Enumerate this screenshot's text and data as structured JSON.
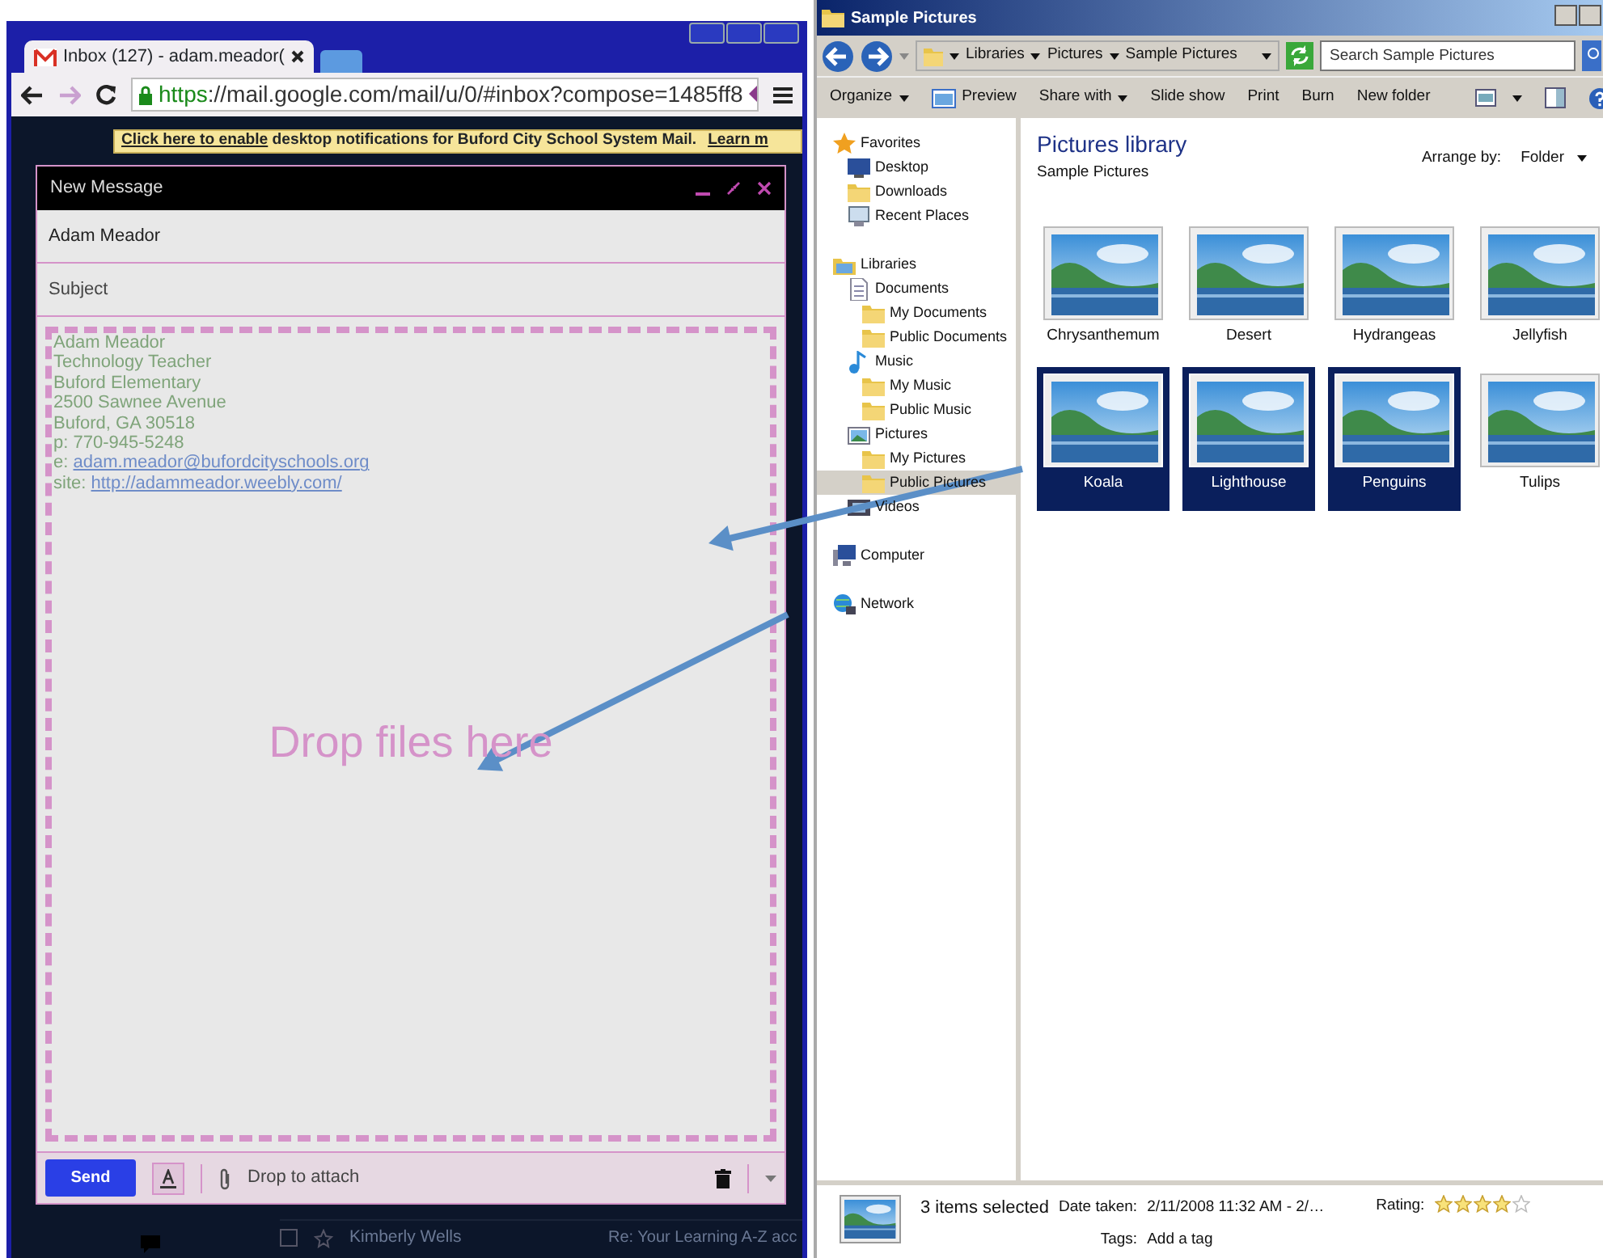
{
  "browser": {
    "tab_title": "Inbox (127) - adam.meador(",
    "url": "https://mail.google.com/mail/u/0/#inbox?compose=1485ff8",
    "notification": {
      "link": "Click here to enable",
      "text": " desktop notifications for Buford City School System Mail.",
      "learn_more": "Learn m"
    },
    "inbox_rows": [
      {
        "sender": "Kimberly Wells",
        "subject": "Re: Your Learning A-Z acc",
        "checked": false
      }
    ]
  },
  "compose": {
    "title": "New Message",
    "to": "Adam Meador",
    "subject_placeholder": "Subject",
    "signature": [
      {
        "text": "Adam Meador"
      },
      {
        "text": "Technology Teacher"
      },
      {
        "text": "Buford Elementary"
      },
      {
        "text": "2500 Sawnee Avenue"
      },
      {
        "text": "Buford, GA 30518"
      },
      {
        "text": "p: 770-945-5248"
      },
      {
        "text": "e:",
        "link": "adam.meador@bufordcityschools.org"
      },
      {
        "text": "site:",
        "link": "http://adammeador.weebly.com/"
      }
    ],
    "drop_text": "Drop files here",
    "send": "Send",
    "attach_text": "Drop to attach"
  },
  "explorer": {
    "title": "Sample Pictures",
    "breadcrumb": [
      "Libraries",
      "Pictures",
      "Sample Pictures"
    ],
    "search_placeholder": "Search Sample Pictures",
    "toolbar": [
      {
        "label": "Organize",
        "dropdown": true,
        "kind": "text"
      },
      {
        "label": "Preview",
        "dropdown": false,
        "kind": "preview"
      },
      {
        "label": "Share with",
        "dropdown": true,
        "kind": "text"
      },
      {
        "label": "Slide show",
        "dropdown": false,
        "kind": "text"
      },
      {
        "label": "Print",
        "dropdown": false,
        "kind": "text"
      },
      {
        "label": "Burn",
        "dropdown": false,
        "kind": "text"
      },
      {
        "label": "New folder",
        "dropdown": false,
        "kind": "text"
      }
    ],
    "nav": [
      {
        "label": "Favorites",
        "kind": "star",
        "selected": false,
        "children": [
          {
            "label": "Desktop",
            "kind": "desktop",
            "selected": false
          },
          {
            "label": "Downloads",
            "kind": "folder",
            "selected": false
          },
          {
            "label": "Recent Places",
            "kind": "recent",
            "selected": false
          }
        ]
      },
      {
        "label": "Libraries",
        "kind": "library",
        "selected": false,
        "children": [
          {
            "label": "Documents",
            "kind": "document",
            "selected": false,
            "children": [
              {
                "label": "My Documents",
                "kind": "folder",
                "selected": false
              },
              {
                "label": "Public Documents",
                "kind": "folder",
                "selected": false
              }
            ]
          },
          {
            "label": "Music",
            "kind": "music",
            "selected": false,
            "children": [
              {
                "label": "My Music",
                "kind": "folder",
                "selected": false
              },
              {
                "label": "Public Music",
                "kind": "folder",
                "selected": false
              }
            ]
          },
          {
            "label": "Pictures",
            "kind": "pictures",
            "selected": false,
            "children": [
              {
                "label": "My Pictures",
                "kind": "folder",
                "selected": false
              },
              {
                "label": "Public Pictures",
                "kind": "folder",
                "selected": true
              }
            ]
          },
          {
            "label": "Videos",
            "kind": "videos",
            "selected": false
          }
        ]
      },
      {
        "label": "Computer",
        "kind": "computer",
        "selected": false
      },
      {
        "label": "Network",
        "kind": "network",
        "selected": false
      }
    ],
    "library_title": "Pictures library",
    "library_subtitle": "Sample Pictures",
    "arrange_label": "Arrange by:",
    "arrange_value": "Folder",
    "files": [
      {
        "name": "Chrysanthemum",
        "selected": false
      },
      {
        "name": "Desert",
        "selected": false
      },
      {
        "name": "Hydrangeas",
        "selected": false
      },
      {
        "name": "Jellyfish",
        "selected": false
      },
      {
        "name": "Koala",
        "selected": true
      },
      {
        "name": "Lighthouse",
        "selected": true
      },
      {
        "name": "Penguins",
        "selected": true
      },
      {
        "name": "Tulips",
        "selected": false
      }
    ],
    "details": {
      "count": "3 items selected",
      "date_label": "Date taken:",
      "date_value": "2/11/2008 11:32 AM - 2/…",
      "tags_label": "Tags:",
      "tags_value": "Add a tag",
      "rating_label": "Rating:",
      "stars": 4
    }
  }
}
